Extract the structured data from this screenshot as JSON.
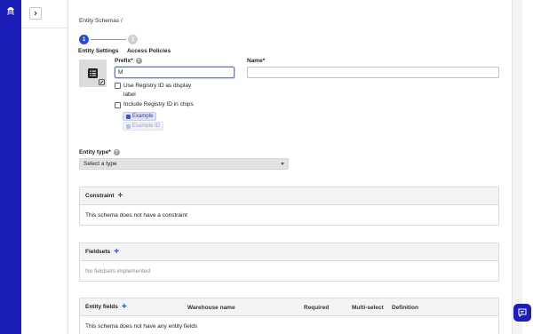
{
  "nav": {
    "expand_icon": "chevron-right-icon",
    "logo_icon": "jellyfish-logo-icon"
  },
  "breadcrumb": "Entity Schemas /",
  "stepper": {
    "steps": [
      {
        "number": "1",
        "label": "Entity Settings",
        "state": "active"
      },
      {
        "number": "2",
        "label": "Access Policies",
        "state": "inactive"
      }
    ],
    "active_color": "#2a4ad9"
  },
  "form": {
    "icon": "list-icon",
    "prefix_label": "Prefix*",
    "prefix_value": "M",
    "name_label": "Name*",
    "name_value": "",
    "use_registry_label": "Use Registry ID as display label",
    "include_registry_label": "Include Registry ID in chips",
    "chip_example": "Example",
    "chip_example_id": "Example ID",
    "entity_type_label": "Entity type*",
    "entity_type_value": "Select a type"
  },
  "panels": {
    "constraint": {
      "title": "Constraint",
      "body": "This schema does not have a constraint"
    },
    "fieldsets": {
      "title": "Fieldsets",
      "body": "No fieldsets implemented"
    },
    "entity_fields": {
      "title": "Entity fields",
      "columns": [
        "Warehouse name",
        "Required",
        "Multi-select",
        "Definition"
      ],
      "body": "This schema does not have any entity fields"
    }
  },
  "colors": {
    "rail": "#1b1fb7",
    "accent": "#2a4ad9"
  }
}
